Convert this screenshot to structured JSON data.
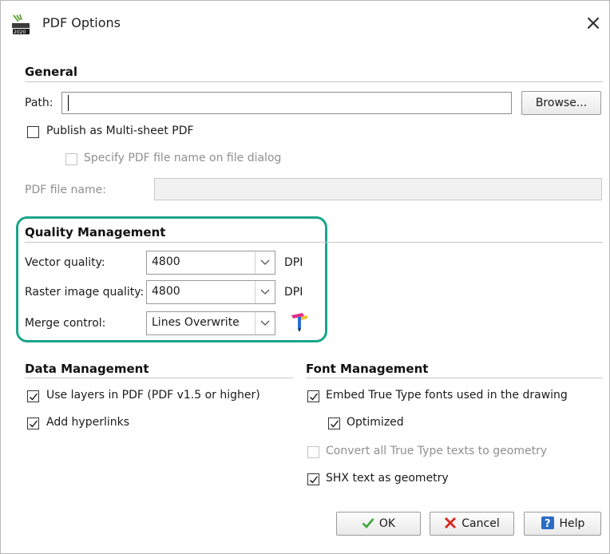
{
  "window": {
    "title": "PDF Options",
    "close_glyph": "×"
  },
  "general": {
    "heading": "General",
    "path_label": "Path:",
    "path_value": "",
    "browse_label": "Browse...",
    "multi_sheet_label": "Publish as Multi-sheet PDF",
    "multi_sheet_checked": false,
    "specify_name_label": "Specify PDF file name on file dialog",
    "specify_name_checked": false,
    "file_name_label": "PDF file name:",
    "file_name_value": ""
  },
  "quality": {
    "heading": "Quality Management",
    "vector_label": "Vector quality:",
    "vector_value": "4800",
    "vector_unit": "DPI",
    "raster_label": "Raster image quality:",
    "raster_value": "4800",
    "raster_unit": "DPI",
    "merge_label": "Merge control:",
    "merge_value": "Lines Overwrite"
  },
  "data_mgmt": {
    "heading": "Data Management",
    "use_layers_label": "Use layers in PDF (PDF v1.5 or higher)",
    "use_layers_checked": true,
    "hyperlinks_label": "Add hyperlinks",
    "hyperlinks_checked": true
  },
  "font_mgmt": {
    "heading": "Font Management",
    "embed_label": "Embed True Type fonts used in the drawing",
    "embed_checked": true,
    "optimized_label": "Optimized",
    "optimized_checked": true,
    "convert_label": "Convert all True Type texts to geometry",
    "convert_checked": false,
    "shx_label": "SHX text as geometry",
    "shx_checked": true
  },
  "buttons": {
    "ok": "OK",
    "cancel": "Cancel",
    "help": "Help"
  },
  "colors": {
    "highlight": "#1aa58a",
    "ok_check": "#3aa53a",
    "cancel_x": "#d9261c",
    "help_blue": "#2d6cc6"
  }
}
